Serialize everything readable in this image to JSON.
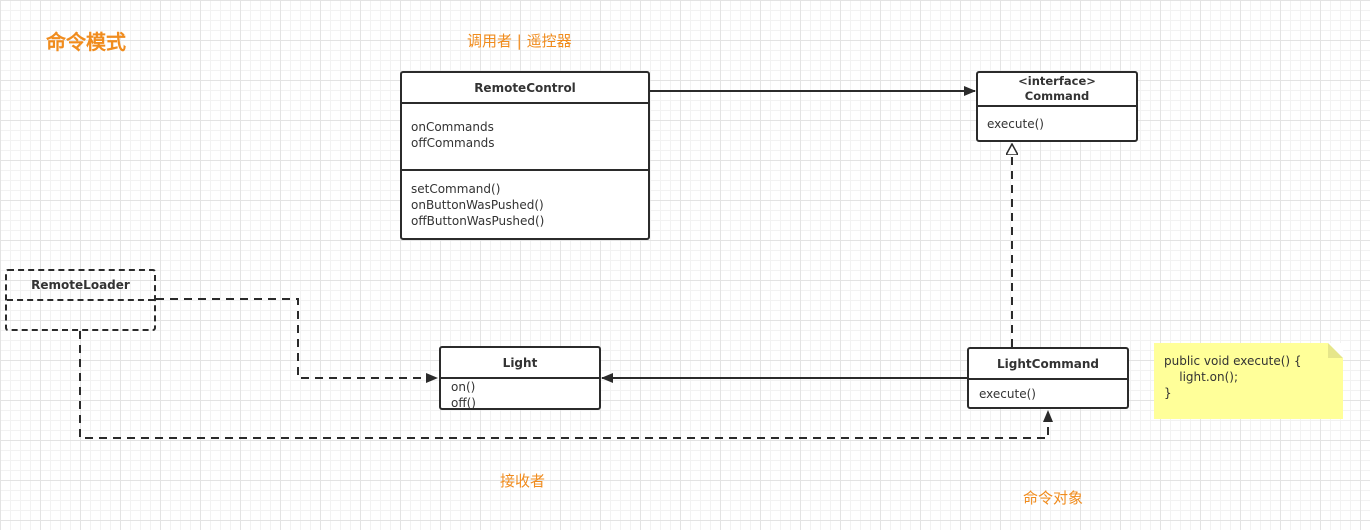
{
  "labels": {
    "title": "命令模式",
    "invoker": "调用者 | 遥控器",
    "receiver": "接收者",
    "command_object": "命令对象"
  },
  "classes": {
    "remote_control": {
      "name": "RemoteControl",
      "fields": [
        "onCommands",
        "offCommands"
      ],
      "methods": [
        "setCommand()",
        "onButtonWasPushed()",
        "offButtonWasPushed()"
      ]
    },
    "command": {
      "stereotype": "<interface>",
      "name": "Command",
      "methods": [
        "execute()"
      ]
    },
    "remote_loader": {
      "name": "RemoteLoader"
    },
    "light": {
      "name": "Light",
      "methods": [
        "on()",
        "off()"
      ]
    },
    "light_command": {
      "name": "LightCommand",
      "methods": [
        "execute()"
      ]
    }
  },
  "note": {
    "lines": [
      "public void execute() {",
      "    light.on();",
      "}"
    ]
  },
  "colors": {
    "label": "#f08c1e",
    "note_bg": "#ffff99",
    "line": "#2b2b2b"
  }
}
